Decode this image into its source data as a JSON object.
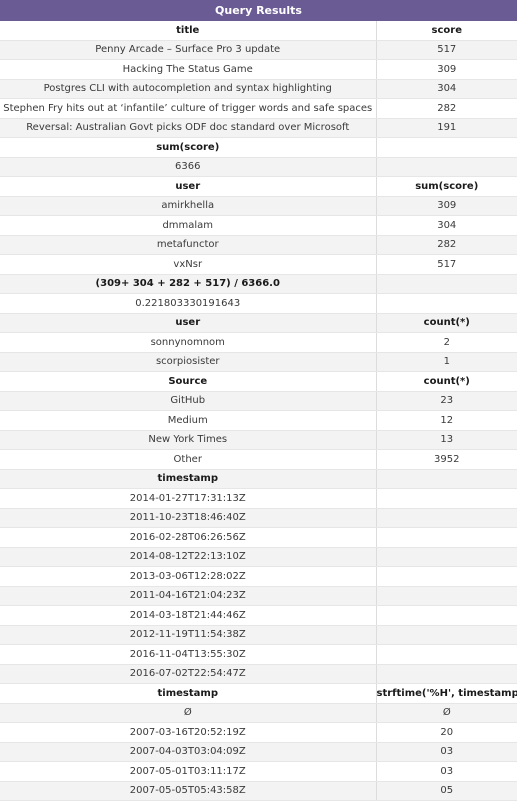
{
  "header": {
    "title": "Query Results"
  },
  "sections": [
    {
      "columns": [
        "title",
        "score"
      ],
      "rows": [
        [
          "Penny Arcade – Surface Pro 3 update",
          "517"
        ],
        [
          "Hacking The Status Game",
          "309"
        ],
        [
          "Postgres CLI with autocompletion and syntax highlighting",
          "304"
        ],
        [
          "Stephen Fry hits out at ‘infantile’ culture of trigger words and safe spaces",
          "282"
        ],
        [
          "Reversal: Australian Govt picks ODF doc standard over Microsoft",
          "191"
        ]
      ]
    },
    {
      "columns": [
        "sum(score)",
        ""
      ],
      "rows": [
        [
          "6366",
          ""
        ]
      ]
    },
    {
      "columns": [
        "user",
        "sum(score)"
      ],
      "rows": [
        [
          "amirkhella",
          "309"
        ],
        [
          "dmmalam",
          "304"
        ],
        [
          "metafunctor",
          "282"
        ],
        [
          "vxNsr",
          "517"
        ]
      ]
    },
    {
      "columns": [
        "(309+ 304 + 282 + 517) / 6366.0",
        ""
      ],
      "rows": [
        [
          "0.221803330191643",
          ""
        ]
      ]
    },
    {
      "columns": [
        "user",
        "count(*)"
      ],
      "rows": [
        [
          "sonnynomnom",
          "2"
        ],
        [
          "scorpiosister",
          "1"
        ]
      ]
    },
    {
      "columns": [
        "Source",
        "count(*)"
      ],
      "rows": [
        [
          "GitHub",
          "23"
        ],
        [
          "Medium",
          "12"
        ],
        [
          "New York Times",
          "13"
        ],
        [
          "Other",
          "3952"
        ]
      ]
    },
    {
      "columns": [
        "timestamp",
        ""
      ],
      "rows": [
        [
          "2014-01-27T17:31:13Z",
          ""
        ],
        [
          "2011-10-23T18:46:40Z",
          ""
        ],
        [
          "2016-02-28T06:26:56Z",
          ""
        ],
        [
          "2014-08-12T22:13:10Z",
          ""
        ],
        [
          "2013-03-06T12:28:02Z",
          ""
        ],
        [
          "2011-04-16T21:04:23Z",
          ""
        ],
        [
          "2014-03-18T21:44:46Z",
          ""
        ],
        [
          "2012-11-19T11:54:38Z",
          ""
        ],
        [
          "2016-11-04T13:55:30Z",
          ""
        ],
        [
          "2016-07-02T22:54:47Z",
          ""
        ]
      ]
    },
    {
      "columns": [
        "timestamp",
        "strftime('%H', timestamp)"
      ],
      "rows": [
        [
          "Ø",
          "Ø"
        ],
        [
          "2007-03-16T20:52:19Z",
          "20"
        ],
        [
          "2007-04-03T03:04:09Z",
          "03"
        ],
        [
          "2007-05-01T03:11:17Z",
          "03"
        ],
        [
          "2007-05-05T05:43:58Z",
          "05"
        ]
      ]
    }
  ]
}
